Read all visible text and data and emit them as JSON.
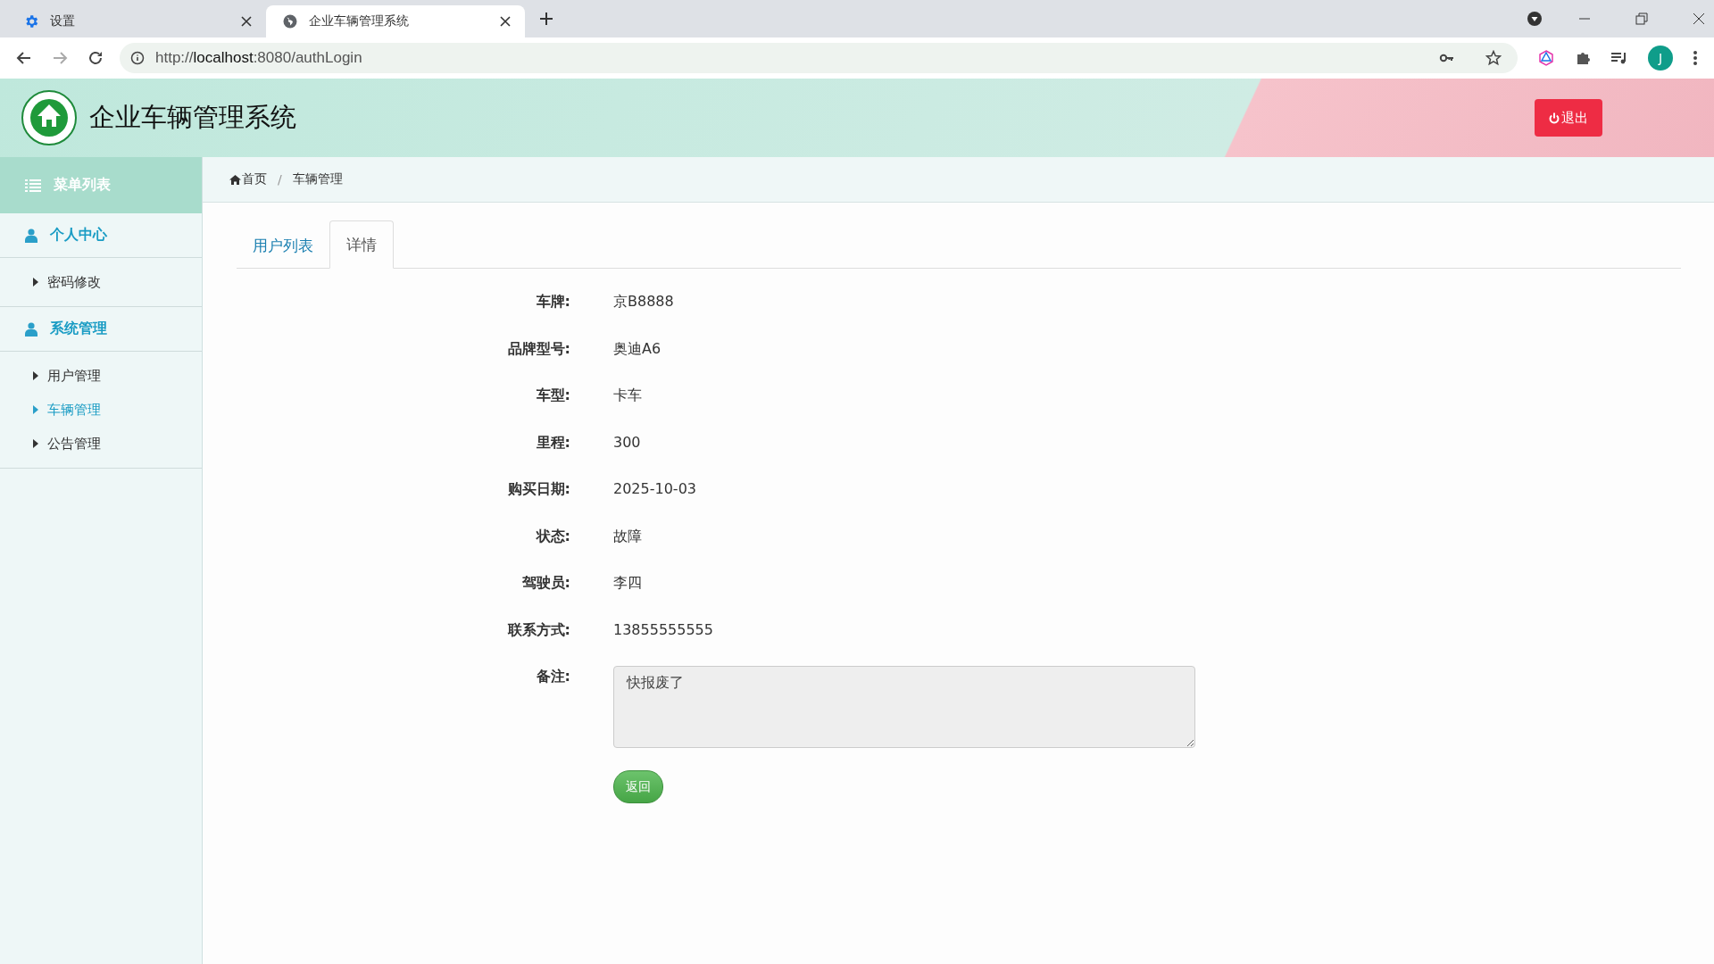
{
  "browser": {
    "tabs": [
      {
        "title": "设置",
        "kind": "settings",
        "selected": false
      },
      {
        "title": "企业车辆管理系统",
        "kind": "web",
        "selected": true
      }
    ],
    "url_host": "localhost",
    "url_prefix": "http://",
    "url_rest": ":8080/authLogin",
    "profile_initial": "J"
  },
  "header": {
    "title": "企业车辆管理系统",
    "logout": "退出"
  },
  "sidebar": {
    "menu_title": "菜单列表",
    "groups": [
      {
        "label": "个人中心",
        "items": [
          {
            "label": "密码修改",
            "selected": false
          }
        ]
      },
      {
        "label": "系统管理",
        "items": [
          {
            "label": "用户管理",
            "selected": false
          },
          {
            "label": "车辆管理",
            "selected": true
          },
          {
            "label": "公告管理",
            "selected": false
          }
        ]
      }
    ]
  },
  "breadcrumb": [
    "首页",
    "车辆管理"
  ],
  "breadcrumb_separator": "/",
  "tabs": [
    {
      "label": "用户列表",
      "selected": false
    },
    {
      "label": "详情",
      "selected": true
    }
  ],
  "details": [
    {
      "label": "车牌:",
      "value": "京B8888"
    },
    {
      "label": "品牌型号:",
      "value": "奥迪A6"
    },
    {
      "label": "车型:",
      "value": "卡车"
    },
    {
      "label": "里程:",
      "value": "300"
    },
    {
      "label": "购买日期:",
      "value": "2025-10-03"
    },
    {
      "label": "状态:",
      "value": "故障"
    },
    {
      "label": "驾驶员:",
      "value": "李四"
    },
    {
      "label": "联系方式:",
      "value": "13855555555"
    }
  ],
  "remark": {
    "label": "备注:",
    "value": "快报废了"
  },
  "back_button": "返回"
}
